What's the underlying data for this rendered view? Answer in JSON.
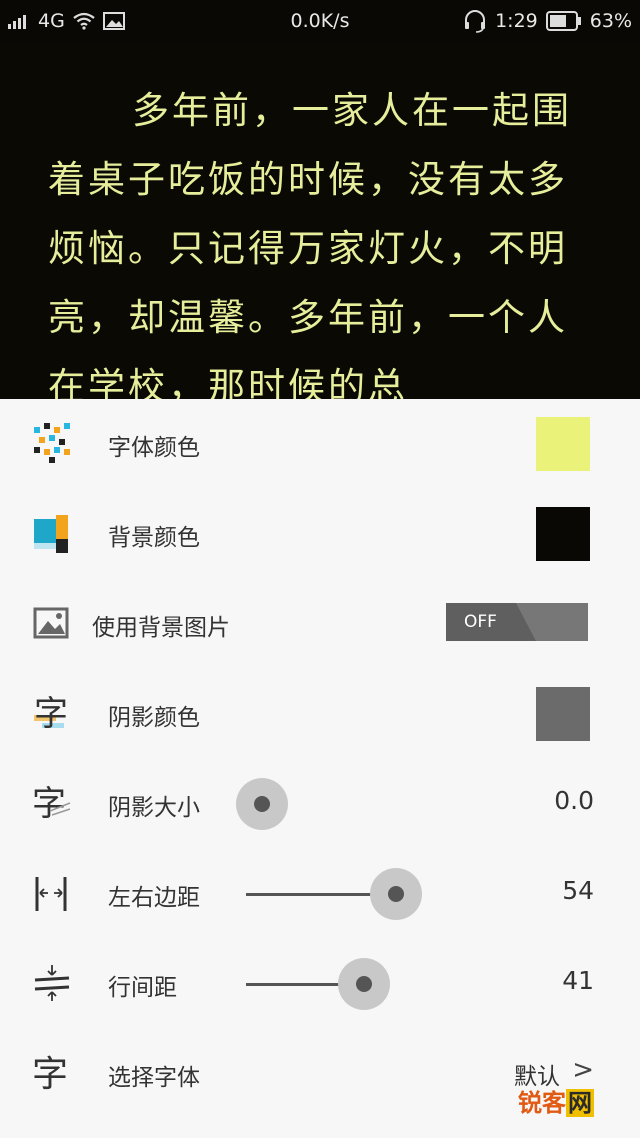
{
  "status_bar": {
    "network": "4G",
    "speed": "0.0K/s",
    "time": "1:29",
    "battery": "63%"
  },
  "reader": {
    "text": "多年前，一家人在一起围着桌子吃饭的时候，没有太多烦恼。只记得万家灯火，不明亮，却温馨。多年前，一个人在学校，那时候的总"
  },
  "settings": {
    "font_color": {
      "label": "字体颜色",
      "color": "#eaf27a"
    },
    "bg_color": {
      "label": "背景颜色",
      "color": "#0a0804"
    },
    "bg_image": {
      "label": "使用背景图片",
      "toggle": "OFF"
    },
    "shadow_color": {
      "label": "阴影颜色",
      "color": "#6b6b6b"
    },
    "shadow_size": {
      "label": "阴影大小",
      "value": "0.0",
      "level": 0.0
    },
    "margin": {
      "label": "左右边距",
      "value": "54",
      "level": 0.54
    },
    "line_spacing": {
      "label": "行间距",
      "value": "41",
      "level": 0.41
    },
    "font": {
      "label": "选择字体",
      "value": "默认",
      "chevron": ">"
    }
  },
  "watermark": {
    "part1": "锐客",
    "part2": "网"
  },
  "icons": {
    "signal": "signal-icon",
    "wifi": "wifi-icon",
    "image": "image-icon",
    "headset": "headset-icon",
    "battery": "battery-icon"
  }
}
